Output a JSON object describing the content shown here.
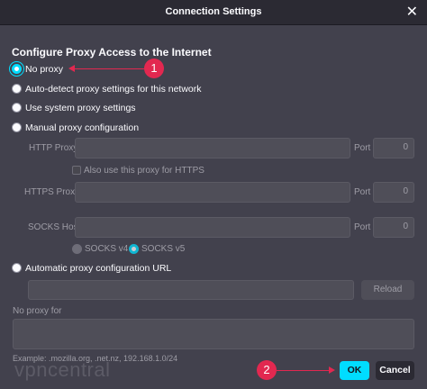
{
  "window": {
    "title": "Connection Settings",
    "close_glyph": "✕"
  },
  "heading": "Configure Proxy Access to the Internet",
  "options": {
    "no_proxy": "No proxy",
    "auto_detect": "Auto-detect proxy settings for this network",
    "system": "Use system proxy settings",
    "manual": "Manual proxy configuration",
    "automatic_url": "Automatic proxy configuration URL"
  },
  "selected_option": "no_proxy",
  "manual": {
    "http_label": "HTTP Proxy",
    "https_label": "HTTPS Proxy",
    "socks_label": "SOCKS Host",
    "port_label": "Port",
    "http_port": "0",
    "https_port": "0",
    "socks_port": "0",
    "also_https": "Also use this proxy for HTTPS",
    "socks_v4": "SOCKS v4",
    "socks_v5": "SOCKS v5"
  },
  "reload_label": "Reload",
  "no_proxy_for_label": "No proxy for",
  "example_text": "Example: .mozilla.org, .net.nz, 192.168.1.0/24",
  "buttons": {
    "ok": "OK",
    "cancel": "Cancel"
  },
  "annotations": {
    "marker1": "1",
    "marker2": "2"
  },
  "watermark": "vpncentral",
  "colors": {
    "accent": "#00ddff",
    "annotation": "#e22850",
    "background": "#42414d"
  }
}
